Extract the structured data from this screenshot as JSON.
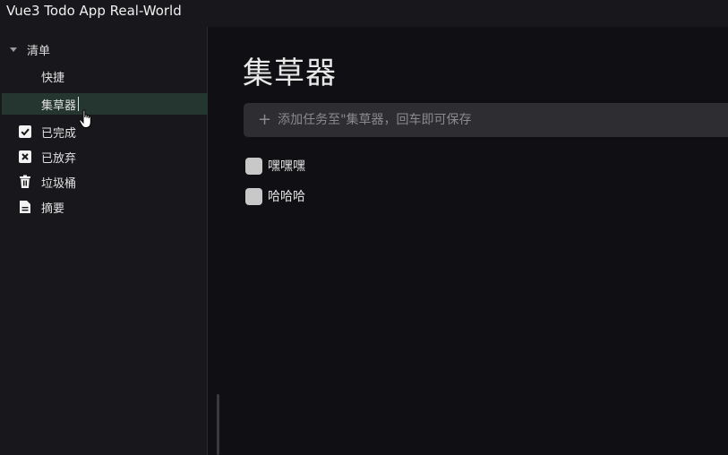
{
  "app": {
    "title": "Vue3 Todo App Real-World"
  },
  "sidebar": {
    "tree_label": "清单",
    "lists": [
      {
        "label": "快捷"
      },
      {
        "label": "集草器",
        "active": true
      }
    ],
    "nav": [
      {
        "label": "已完成",
        "icon": "check-square-icon"
      },
      {
        "label": "已放弃",
        "icon": "x-square-icon"
      },
      {
        "label": "垃圾桶",
        "icon": "trash-icon"
      },
      {
        "label": "摘要",
        "icon": "document-icon"
      }
    ]
  },
  "main": {
    "title": "集草器",
    "add_placeholder": "添加任务至\"集草器，回车即可保存",
    "tasks": [
      {
        "label": "嘿嘿嘿",
        "done": false
      },
      {
        "label": "哈哈哈",
        "done": false
      }
    ]
  },
  "colors": {
    "background": "#101014",
    "sidebar": "#18181c",
    "active_item": "#25352f",
    "input_bg": "#2e2e32"
  }
}
